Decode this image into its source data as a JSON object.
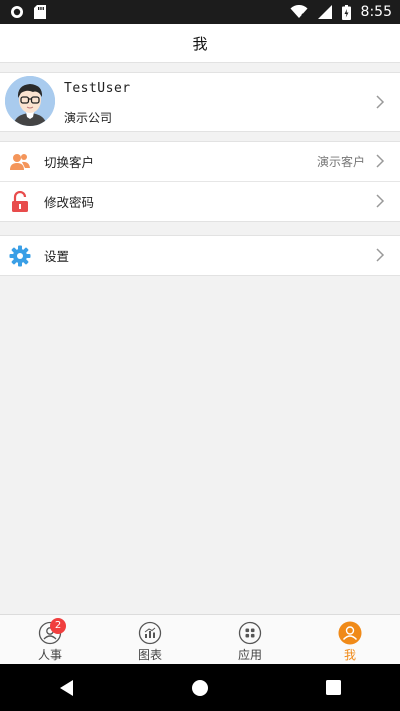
{
  "status_bar": {
    "time": "8:55",
    "icons": [
      "circle-notification-icon",
      "sd-card-icon",
      "wifi-icon",
      "signal-icon",
      "battery-icon"
    ]
  },
  "header": {
    "title": "我"
  },
  "profile": {
    "username": "TestUser",
    "company": "演示公司"
  },
  "menu": {
    "groups": [
      {
        "items": [
          {
            "label": "切换客户",
            "value": "演示客户",
            "icon": "switch-customer-icon",
            "icon_color": "#f4955a"
          },
          {
            "label": "修改密码",
            "value": "",
            "icon": "lock-icon",
            "icon_color": "#e84c4c"
          }
        ]
      },
      {
        "items": [
          {
            "label": "设置",
            "value": "",
            "icon": "gear-icon",
            "icon_color": "#3a9fe6"
          }
        ]
      }
    ]
  },
  "tabs": [
    {
      "label": "人事",
      "icon": "person-icon",
      "badge": "2",
      "active": false
    },
    {
      "label": "图表",
      "icon": "chart-icon",
      "badge": "",
      "active": false
    },
    {
      "label": "应用",
      "icon": "apps-icon",
      "badge": "",
      "active": false
    },
    {
      "label": "我",
      "icon": "user-icon",
      "badge": "",
      "active": true
    }
  ],
  "colors": {
    "accent": "#f08a18",
    "badge": "#f03e3e"
  }
}
